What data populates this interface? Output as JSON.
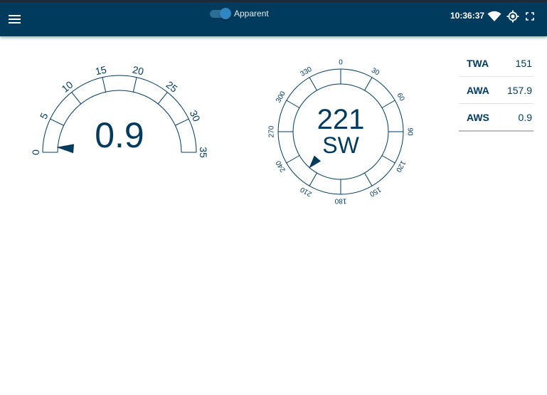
{
  "header": {
    "mode_label": "Apparent",
    "mode_on": true,
    "time": "10:36:37"
  },
  "speed_gauge": {
    "value": "0.9",
    "value_num": 0.9,
    "min": 0,
    "max": 35,
    "ticks": [
      "0",
      "5",
      "10",
      "15",
      "20",
      "25",
      "30",
      "35"
    ]
  },
  "compass": {
    "heading": "221",
    "cardinal": "SW",
    "pointer_deg": 221,
    "ticks": [
      "0",
      "30",
      "60",
      "90",
      "120",
      "150",
      "180",
      "210",
      "240",
      "270",
      "300",
      "330"
    ]
  },
  "wind_table": [
    {
      "label": "TWA",
      "value": "151"
    },
    {
      "label": "AWA",
      "value": "157.9"
    },
    {
      "label": "AWS",
      "value": "0.9"
    }
  ],
  "colors": {
    "appbar": "#003a5c",
    "gauge": "#003a5c"
  }
}
